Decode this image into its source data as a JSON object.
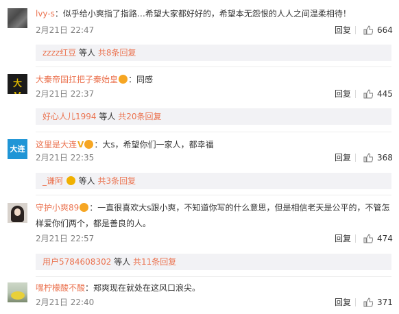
{
  "comments": [
    {
      "username": "lvy-s",
      "text": "：似乎给小爽指了指路…希望大家都好好的，希望本无怨恨的人人之间温柔相待！",
      "time": "2月21日 22:47",
      "reply": "回复",
      "likes": "664",
      "avatar": "gray-photo-avatar",
      "sub": {
        "user": "zzzz红豆",
        "mid": "等人",
        "count": "共8条回复"
      }
    },
    {
      "username": "大秦帝国扛把子秦始皇",
      "text": "：同感",
      "time": "2月21日 22:37",
      "reply": "回复",
      "likes": "445",
      "avatar": "dark-text-avatar",
      "avatar_text": "大V",
      "sub": {
        "user": "好心人儿1994",
        "mid": "等人",
        "count": "共20条回复"
      }
    },
    {
      "username": "这里是大连",
      "text": "：大s，希望你们一家人，都幸福",
      "time": "2月21日 22:35",
      "reply": "回复",
      "likes": "368",
      "avatar": "blue-logo-avatar",
      "avatar_text": "大连",
      "sub": {
        "user": "_谦阿",
        "mid": "等人",
        "count": "共3条回复"
      }
    },
    {
      "username": "守护小爽89",
      "text_line1": "：一直很喜欢大s跟小爽，不知道你写的什么意思，但是相信老天是公平的，不管怎",
      "text_line2": "样爱你们两个，都是善良的人。",
      "time": "2月21日 22:57",
      "reply": "回复",
      "likes": "474",
      "avatar": "portrait-avatar",
      "sub": {
        "user": "用户5784608302",
        "mid": "等人",
        "count": "共11条回复"
      }
    },
    {
      "username": "嘿柠檬酸不酸",
      "text": "：郑爽现在就处在这风口浪尖。",
      "time": "2月21日 22:40",
      "reply": "回复",
      "likes": "371",
      "avatar": "lemon-avatar"
    }
  ],
  "colors": {
    "username": "#eb7350",
    "text": "#333333",
    "meta": "#808080",
    "subbox_bg": "#f2f2f5"
  }
}
